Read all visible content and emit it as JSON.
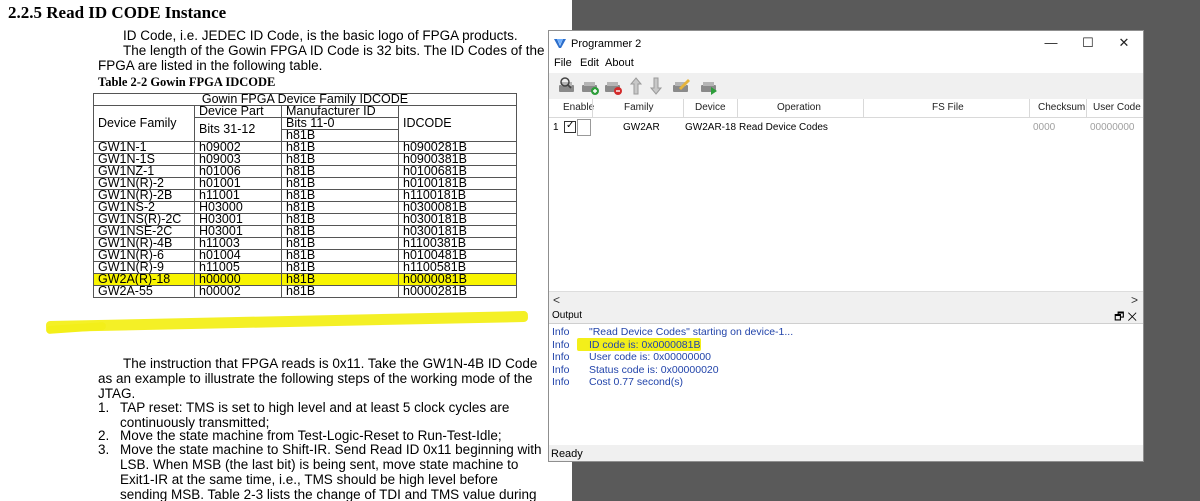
{
  "document": {
    "section_title": "2.2.5 Read ID CODE Instance",
    "intro_lines": [
      "ID Code, i.e. JEDEC ID Code, is the basic logo of FPGA products.",
      "The length of the Gowin FPGA ID Code is 32 bits. The ID Codes of the",
      "FPGA are listed in the following table."
    ],
    "table_caption": "Table 2-2 Gowin FPGA IDCODE",
    "table": {
      "title": "Gowin FPGA Device Family IDCODE",
      "col_device_family": "Device Family",
      "col_device_part": "Device Part",
      "col_bits_31_12": "Bits 31-12",
      "col_manufacturer_id": "Manufacturer ID",
      "col_bits_11_0": "Bits 11-0",
      "col_h81b": "h81B",
      "col_idcode": "IDCODE",
      "rows": [
        {
          "family": "GW1N-1",
          "part": "h09002",
          "mfr": "h81B",
          "idcode": "h0900281B"
        },
        {
          "family": "GW1N-1S",
          "part": "h09003",
          "mfr": "h81B",
          "idcode": "h0900381B"
        },
        {
          "family": "GW1NZ-1",
          "part": "h01006",
          "mfr": "h81B",
          "idcode": "h0100681B"
        },
        {
          "family": "GW1N(R)-2",
          "part": "h01001",
          "mfr": "h81B",
          "idcode": "h0100181B"
        },
        {
          "family": "GW1N(R)-2B",
          "part": "h11001",
          "mfr": "h81B",
          "idcode": "h1100181B"
        },
        {
          "family": "GW1NS-2",
          "part": "H03000",
          "mfr": "h81B",
          "idcode": "h0300081B"
        },
        {
          "family": "GW1NS(R)-2C",
          "part": "H03001",
          "mfr": "h81B",
          "idcode": "h0300181B"
        },
        {
          "family": "GW1NSE-2C",
          "part": "H03001",
          "mfr": "h81B",
          "idcode": "h0300181B"
        },
        {
          "family": "GW1N(R)-4B",
          "part": "h11003",
          "mfr": "h81B",
          "idcode": "h1100381B"
        },
        {
          "family": "GW1N(R)-6",
          "part": "h01004",
          "mfr": "h81B",
          "idcode": "h0100481B"
        },
        {
          "family": "GW1N(R)-9",
          "part": "h11005",
          "mfr": "h81B",
          "idcode": "h1100581B"
        },
        {
          "family": "GW2A(R)-18",
          "part": "h00000",
          "mfr": "h81B",
          "idcode": "h0000081B",
          "highlight": true
        },
        {
          "family": "GW2A-55",
          "part": "h00002",
          "mfr": "h81B",
          "idcode": "h0000281B"
        }
      ]
    },
    "body_lines": [
      "The instruction that FPGA reads is 0x11. Take the GW1N-4B ID Code",
      "as an example to illustrate the following steps of the working mode of the",
      "JTAG."
    ],
    "list": [
      {
        "num": "1.",
        "lines": [
          "TAP reset: TMS is set to high level and at least 5 clock cycles are",
          "continuously transmitted;"
        ]
      },
      {
        "num": "2.",
        "lines": [
          "Move the state machine from Test-Logic-Reset to Run-Test-Idle;"
        ]
      },
      {
        "num": "3.",
        "lines": [
          "Move the state machine to Shift-IR. Send Read ID 0x11 beginning with",
          "LSB. When MSB (the last bit) is being sent, move state machine to",
          "Exit1-IR at the same time, i.e., TMS should be high level before",
          "sending MSB. Table 2-3 lists the change of TDI and TMS value during"
        ]
      }
    ],
    "highlight_color": "#f3ef1a"
  },
  "programmer": {
    "window_title": "Programmer 2",
    "controls": {
      "minimize": "—",
      "maximize": "☐",
      "close": "✕"
    },
    "menu": [
      "File",
      "Edit",
      "About"
    ],
    "toolbar_icons": [
      "scan-device-icon",
      "add-device-icon",
      "remove-device-icon",
      "move-up-icon",
      "move-down-icon",
      "config-device-icon",
      "program-device-icon"
    ],
    "grid_headers": {
      "enable": "Enable",
      "family": "Family",
      "device": "Device",
      "operation": "Operation",
      "fs_file": "FS File",
      "checksum": "Checksum",
      "user_code": "User Code"
    },
    "row": {
      "index": "1",
      "checked": "✓",
      "family": "GW2AR",
      "device": "GW2AR-18",
      "operation": "Read Device Codes",
      "checksum": "0000",
      "user_code": "00000000"
    },
    "scroll": {
      "left": "<",
      "right": ">"
    },
    "output": {
      "title": "Output",
      "controls": "🗗 ✕",
      "lines": [
        {
          "level": "Info",
          "text": "\"Read Device Codes\" starting on device-1..."
        },
        {
          "level": "Info",
          "text": "ID code is: 0x0000081B",
          "highlight": true
        },
        {
          "level": "Info",
          "text": "User code is: 0x00000000"
        },
        {
          "level": "Info",
          "text": "Status code is: 0x00000020"
        },
        {
          "level": "Info",
          "text": "Cost 0.77 second(s)"
        }
      ]
    },
    "status": "Ready",
    "colors": {
      "accent": "#2c6ecb",
      "info_text": "#2244aa",
      "background": "#5a5a5a"
    }
  }
}
